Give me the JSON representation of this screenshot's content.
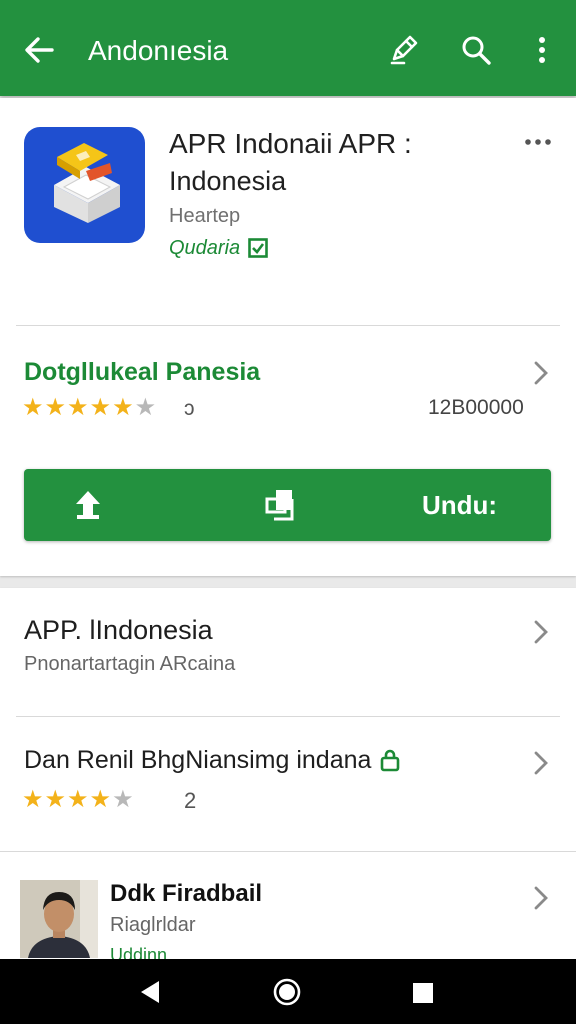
{
  "colors": {
    "brand_green": "#23913f",
    "accent_green": "#1c8a36",
    "star": "#f3b21a",
    "icon_blue": "#1f4fd0"
  },
  "toolbar": {
    "title": "Andonıesia",
    "icons": [
      "back-arrow-icon",
      "edit-icon",
      "search-icon",
      "more-vert-icon"
    ]
  },
  "app": {
    "title_line1": "APR Indonaii APR :",
    "title_line2": "Indonesia",
    "developer": "Heartep",
    "category": "Qudaria",
    "badge_icon": "verified-icon",
    "overflow_icon": "more-horiz-icon"
  },
  "rating_section": {
    "title": "Dotgllukeal Panesia",
    "rating": 4,
    "rating_suffix": "ɔ",
    "downloads": "12B00000"
  },
  "install_button": {
    "label": "Undu:",
    "icons": [
      "upload-icon",
      "copy-icon"
    ]
  },
  "list": [
    {
      "title": "APP. lIndonesia",
      "subtitle": "Pnonartartagin ARcaina"
    },
    {
      "title": "Dan Renil BhgNiansimg indana",
      "title_icon": "lock-icon",
      "rating": 4,
      "rating_count": "2"
    },
    {
      "title": "Ddk Firadbail",
      "subtitle": "Riaglrldar",
      "extra": "Uddinn"
    }
  ],
  "system_nav": [
    "back-triangle-icon",
    "home-circle-icon",
    "recents-square-icon"
  ]
}
